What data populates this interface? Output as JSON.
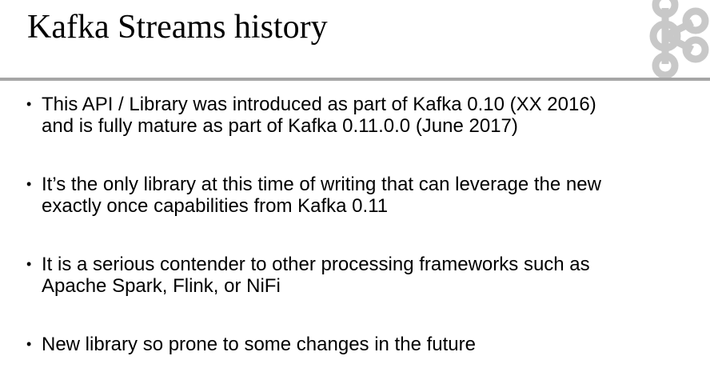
{
  "slide": {
    "title": "Kafka Streams history",
    "bullet_glyph": "•",
    "logo_icon": "kafka-logo-icon",
    "rule_color": "#a6a6a6",
    "logo_color": "#c8c8c8",
    "bullets": [
      {
        "line1": "This API / Library was introduced as part of Kafka 0.10 (XX 2016)",
        "line2": "and is fully mature as part of Kafka 0.11.0.0 (June 2017)"
      },
      {
        "line1": "It’s the only library at this time of writing that can leverage the new",
        "line2": "exactly once capabilities from Kafka 0.11"
      },
      {
        "line1": "It is a serious contender to other processing frameworks such as",
        "line2": "Apache Spark, Flink, or NiFi"
      },
      {
        "line1": "New library so prone to some changes in the future",
        "line2": ""
      }
    ]
  }
}
